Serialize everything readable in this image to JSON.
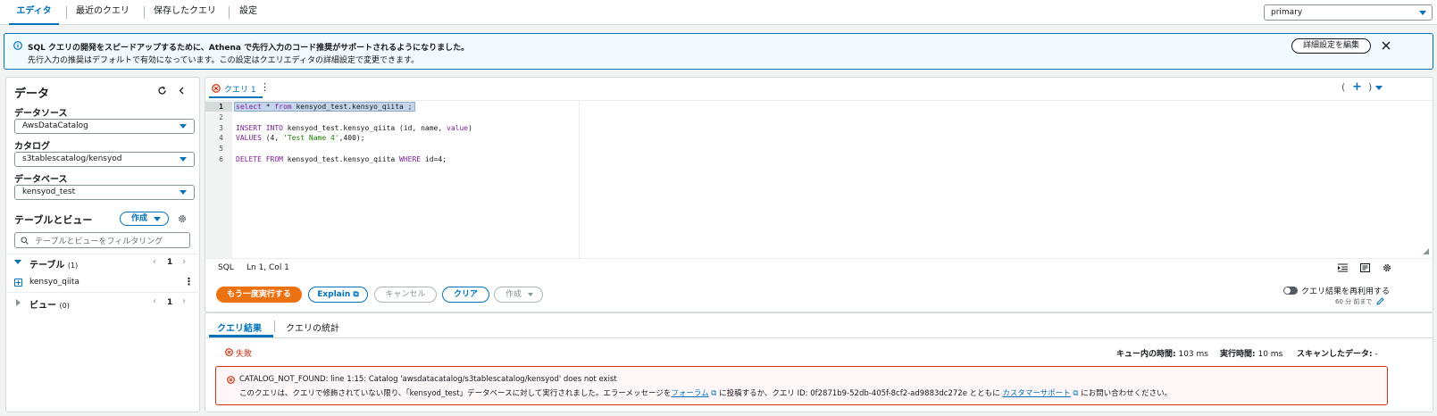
{
  "tabs": [
    "エディタ",
    "最近のクエリ",
    "保存したクエリ",
    "設定"
  ],
  "workgroup": "primary",
  "banner": {
    "title": "SQL クエリの開発をスピードアップするために、Athena で先行入力のコード推奨がサポートされるようになりました。",
    "text": "先行入力の推奨はデフォルトで有効になっています。この設定はクエリエディタの詳細設定で変更できます。",
    "button": "詳細設定を編集"
  },
  "sidebar": {
    "title": "データ",
    "datasource_label": "データソース",
    "datasource": "AwsDataCatalog",
    "catalog_label": "カタログ",
    "catalog": "s3tablescatalog/kensyod",
    "database_label": "データベース",
    "database": "kensyod_test",
    "tables_title": "テーブルとビュー",
    "create": "作成",
    "filter_placeholder": "テーブルとビューをフィルタリング",
    "tables_label": "テーブル",
    "tables_count": "(1)",
    "page": "1",
    "table_item": "kensyo_qiita",
    "views_label": "ビュー",
    "views_count": "(0)",
    "views_page": "1"
  },
  "editor": {
    "tab": "クエリ 1",
    "lines": [
      {
        "n": "1",
        "html": "<span class='kw'>select</span> * <span class='kw'>from</span> kensyod_test.kensyo_qiita ;"
      },
      {
        "n": "2",
        "html": ""
      },
      {
        "n": "3",
        "html": "<span class='kw'>INSERT INTO</span> kensyod_test.kensyo_qiita (id, name, <span class='kw'>value</span>)"
      },
      {
        "n": "4",
        "html": "<span class='kw'>VALUES</span> (4, <span class='str'>'Test Name 4'</span>,400);"
      },
      {
        "n": "5",
        "html": ""
      },
      {
        "n": "6",
        "html": "<span class='kw'>DELETE FROM</span> kensyod_test.kensyo_qiita <span class='kw'>WHERE</span> id=4;"
      }
    ],
    "lang": "SQL",
    "pos": "Ln 1, Col 1"
  },
  "actions": {
    "rerun": "もう一度実行する",
    "explain": "Explain",
    "cancel": "キャンセル",
    "clear": "クリア",
    "create": "作成",
    "reuse": "クエリ結果を再利用する",
    "reuse_sub": "60 分 前まで"
  },
  "results": {
    "tab1": "クエリ結果",
    "tab2": "クエリの統計",
    "status": "失敗",
    "queue_label": "キュー内の時間:",
    "queue": "103 ms",
    "exec_label": "実行時間:",
    "exec": "10 ms",
    "scan_label": "スキャンしたデータ:",
    "scan": "-",
    "error_title": "CATALOG_NOT_FOUND: line 1:15: Catalog 'awsdatacatalog/s3tablescatalog/kensyod' does not exist",
    "error_p1": "このクエリは、クエリで修飾されていない限り、「kensyod_test」データベースに対して実行されました。エラーメッセージを",
    "forum": "フォーラム",
    "error_p2": "に投稿するか、クエリ ID: 0f2871b9-52db-405f-8cf2-ad9883dc272e とともに",
    "support": "カスタマーサポート",
    "error_p3": "にお問い合わせください。"
  },
  "colors": {
    "accent": "#0073bb",
    "primary_btn": "#ec7211",
    "error": "#d13212"
  }
}
